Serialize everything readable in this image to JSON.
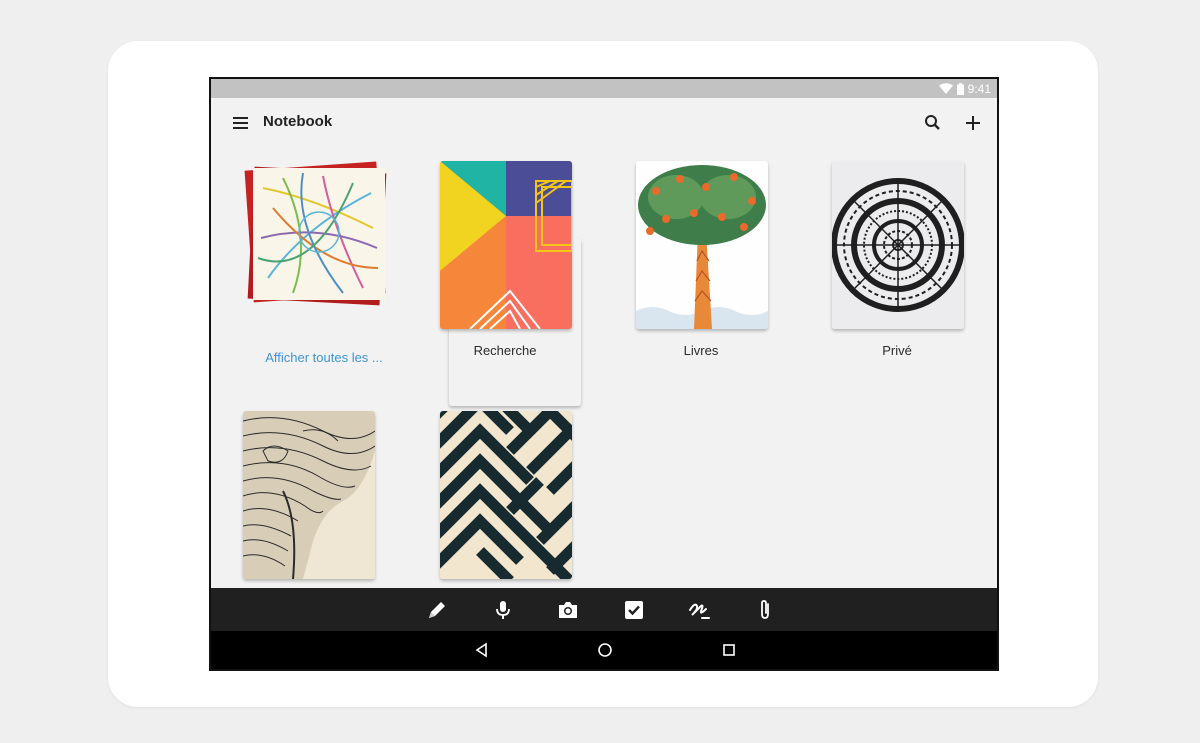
{
  "status_bar": {
    "time": "9:41"
  },
  "app_bar": {
    "title": "Notebook"
  },
  "notebooks": [
    {
      "label": "Afficher toutes les ...",
      "cover": "metro-map"
    },
    {
      "label": "Recherche",
      "cover": "geometric-colors"
    },
    {
      "label": "Livres",
      "cover": "tree-illustration"
    },
    {
      "label": "Privé",
      "cover": "mandala"
    },
    {
      "label": "",
      "cover": "elephant-sketch"
    },
    {
      "label": "",
      "cover": "zigzag-pattern"
    }
  ],
  "toolbar": {
    "tools": [
      "pencil-icon",
      "microphone-icon",
      "camera-icon",
      "checkbox-icon",
      "handwriting-icon",
      "attachment-icon"
    ]
  },
  "colors": {
    "accent": "#3d95d6",
    "toolbar": "#202020",
    "background": "#f2f2f2"
  }
}
